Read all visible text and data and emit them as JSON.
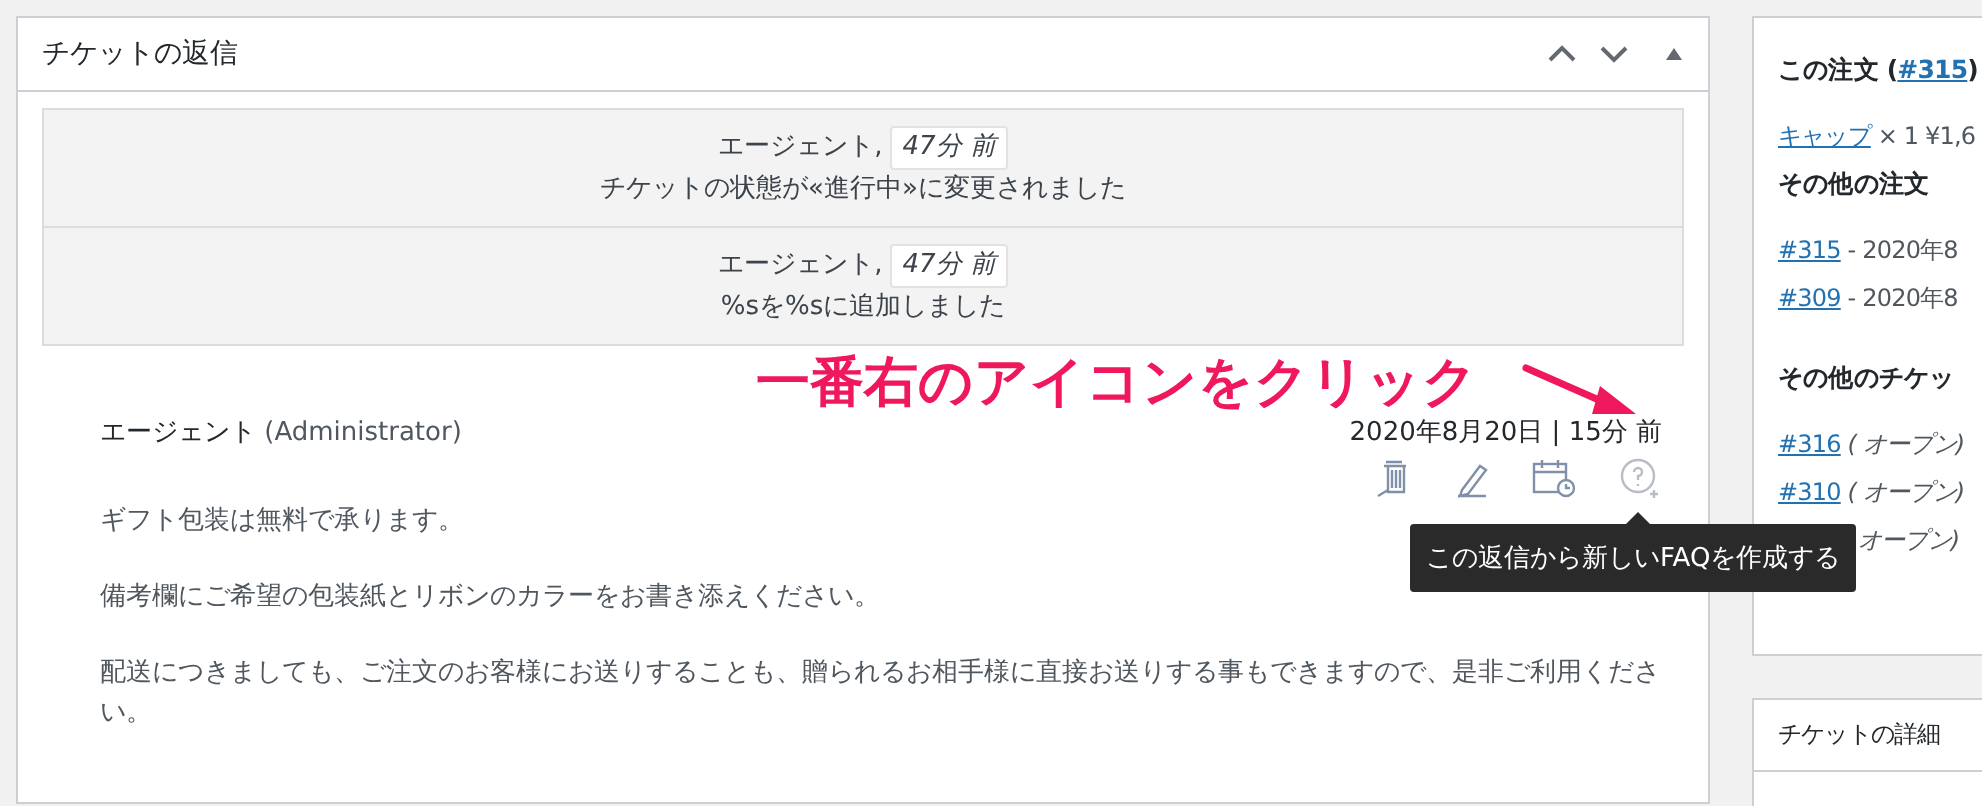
{
  "reply_box": {
    "title": "チケットの返信",
    "events": [
      {
        "author": "エージェント,",
        "time": "47分 前",
        "message": "チケットの状態が«進行中»に変更されました"
      },
      {
        "author": "エージェント,",
        "time": "47分 前",
        "message": "%sを%sに追加しました"
      }
    ],
    "reply": {
      "author": "エージェント",
      "role": "(Administrator)",
      "date": "2020年8月20日 | 15分 前",
      "paragraphs": [
        "ギフト包装は無料で承ります。",
        "備考欄にご希望の包装紙とリボンのカラーをお書き添えください。",
        "配送につきましても、ご注文のお客様にお送りすることも、贈られるお相手様に直接お送りする事もできますので、是非ご利用ください。"
      ]
    },
    "tooltip": "この返信から新しいFAQを作成する"
  },
  "annotation": "一番右のアイコンをクリック",
  "sidebar": {
    "order_title": "この注文 (",
    "order_link": "#315",
    "order_title_end": ")",
    "order_item": {
      "name": "キャップ",
      "rest": "× 1 ¥1,6"
    },
    "other_orders_title": "その他の注文",
    "other_orders": [
      {
        "link": "#315",
        "rest": "- 2020年8"
      },
      {
        "link": "#309",
        "rest": "- 2020年8"
      }
    ],
    "other_tickets_title": "その他のチケッ",
    "other_tickets": [
      {
        "link": "#316",
        "status": "( オープン)"
      },
      {
        "link": "#310",
        "status": "( オープン)"
      },
      {
        "status": "オープン)"
      }
    ]
  },
  "details_box": {
    "title": "チケットの詳細"
  }
}
